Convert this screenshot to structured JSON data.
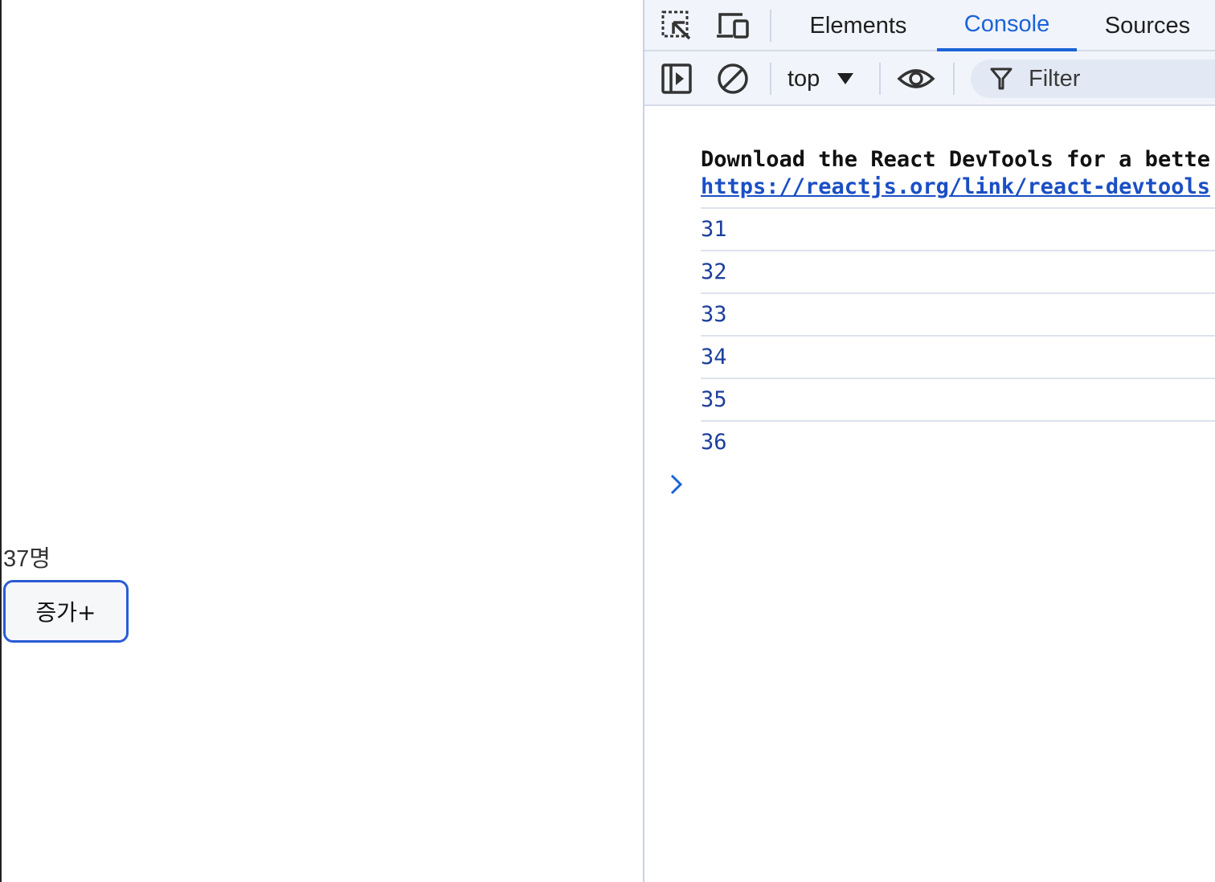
{
  "page": {
    "count_text": "37명",
    "increment_button_label": "증가+"
  },
  "devtools": {
    "tabs": [
      {
        "label": "Elements",
        "active": false
      },
      {
        "label": "Console",
        "active": true
      },
      {
        "label": "Sources",
        "active": false
      }
    ],
    "toolbar": {
      "context_label": "top",
      "filter_placeholder": "Filter"
    },
    "console": {
      "react_message": "Download the React DevTools for a bette",
      "react_link": "https://reactjs.org/link/react-devtools",
      "logs": [
        "31",
        "32",
        "33",
        "34",
        "35",
        "36"
      ]
    },
    "icons": {
      "inspect": "inspect-element-icon",
      "device": "device-toolbar-icon",
      "sidebar": "sidebar-toggle-icon",
      "clear": "clear-console-icon",
      "eye": "live-expression-icon",
      "filter": "filter-icon",
      "prompt": "chevron-right-icon"
    },
    "colors": {
      "accent": "#1a63d8",
      "log_number": "#1c3f9b",
      "link": "#1a4fc4",
      "button_border": "#2a5bd7"
    }
  }
}
